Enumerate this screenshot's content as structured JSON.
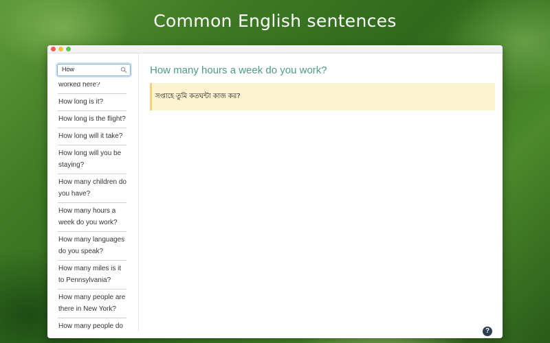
{
  "headline": "Common English sentences",
  "search": {
    "value": "How"
  },
  "sidebar": {
    "items": [
      {
        "label": "worked here?"
      },
      {
        "label": "How long is it?"
      },
      {
        "label": "How long is the flight?"
      },
      {
        "label": "How long will it take?"
      },
      {
        "label": "How long will you be staying?"
      },
      {
        "label": "How many children do you have?"
      },
      {
        "label": "How many hours a week do you work?"
      },
      {
        "label": "How many languages do you speak?"
      },
      {
        "label": "How many miles is it to Pennsylvania?"
      },
      {
        "label": "How many people are there in New York?"
      },
      {
        "label": "How many people do you have in your"
      }
    ]
  },
  "main": {
    "question": "How many hours a week do you work?",
    "answer": "সপ্তাহে তুমি কতঘন্টা কাজ কর?"
  },
  "help": {
    "label": "?"
  },
  "colors": {
    "question": "#4f9b7e",
    "answer_bg": "#fbf2cf",
    "answer_border": "#efd27a",
    "help_bg": "#2f3f52"
  }
}
